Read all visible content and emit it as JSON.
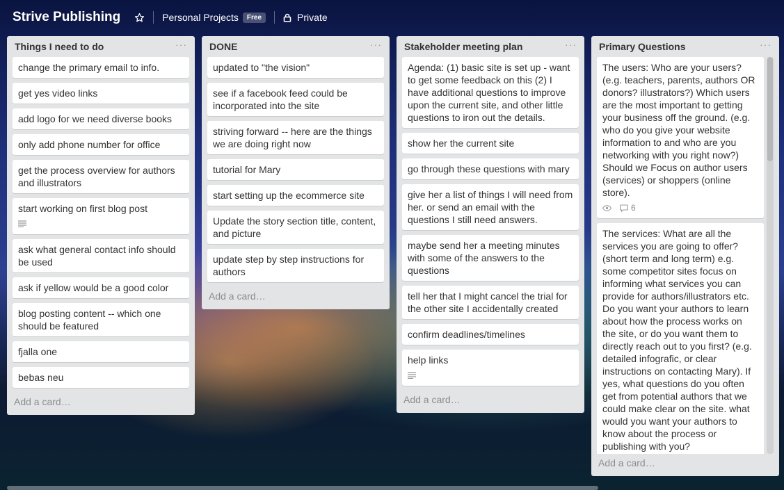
{
  "header": {
    "board_title": "Strive Publishing",
    "team_name": "Personal Projects",
    "team_badge": "Free",
    "privacy_label": "Private",
    "icons": {
      "star": "star-icon",
      "lock": "lock-icon"
    }
  },
  "lists": [
    {
      "title": "Things I need to do",
      "menu": "···",
      "add_card": "Add a card…",
      "cards": [
        {
          "text": "change the primary email to info."
        },
        {
          "text": "get yes video links"
        },
        {
          "text": "add logo for we need diverse books"
        },
        {
          "text": "only add phone number for office"
        },
        {
          "text": "get the process overview for authors and illustrators"
        },
        {
          "text": "start working on first blog post",
          "has_description": true
        },
        {
          "text": "ask what general contact info should be used"
        },
        {
          "text": "ask if yellow would be a good color"
        },
        {
          "text": "blog posting content -- which one should be featured"
        },
        {
          "text": "fjalla one"
        },
        {
          "text": "bebas neu"
        }
      ]
    },
    {
      "title": "DONE",
      "menu": "···",
      "add_card": "Add a card…",
      "cards": [
        {
          "text": "updated to \"the vision\""
        },
        {
          "text": "see if a facebook feed could be incorporated into the site"
        },
        {
          "text": "striving forward -- here are the things we are doing right now"
        },
        {
          "text": "tutorial for Mary"
        },
        {
          "text": "start setting up the ecommerce site"
        },
        {
          "text": "Update the story section title, content, and picture"
        },
        {
          "text": "update step by step instructions for authors"
        }
      ]
    },
    {
      "title": "Stakeholder meeting plan",
      "menu": "···",
      "add_card": "Add a card…",
      "cards": [
        {
          "text": "Agenda: (1) basic site is set up - want to get some feedback on this (2) I have additional questions to improve upon the current site, and other little questions to iron out the details."
        },
        {
          "text": "show her the current site"
        },
        {
          "text": "go through these questions with mary"
        },
        {
          "text": "give her a list of things I will need from her. or send an email with the questions I still need answers."
        },
        {
          "text": "maybe send her a meeting minutes with some of the answers to the questions"
        },
        {
          "text": "tell her that I might cancel the trial for the other site I accidentally created"
        },
        {
          "text": "confirm deadlines/timelines"
        },
        {
          "text": "help links",
          "has_description": true
        }
      ]
    },
    {
      "title": "Primary Questions",
      "menu": "···",
      "add_card": "Add a card…",
      "cards": [
        {
          "text": "The users: Who are your users? (e.g. teachers, parents, authors OR donors? illustrators?) Which users are the most important to getting your business off the ground. (e.g. who do you give your website information to and who are you networking with you right now?) Should we Focus on author users (services) or shoppers (online store).",
          "watching": true,
          "comments": "6"
        },
        {
          "text": "The services: What are all the services you are going to offer? (short term and long term) e.g. some competitor sites focus on informing what services you can provide for authors/illustrators etc. Do you want your authors to learn about how the process works on the site, or do you want them to directly reach out to you first? (e.g. detailed infografic, or clear instructions on contacting Mary). If yes, what questions do you often get from potential authors that we could make clear on the site. what would you want your authors to know about the process or publishing with you?",
          "watching": true,
          "has_description": true
        }
      ]
    }
  ]
}
